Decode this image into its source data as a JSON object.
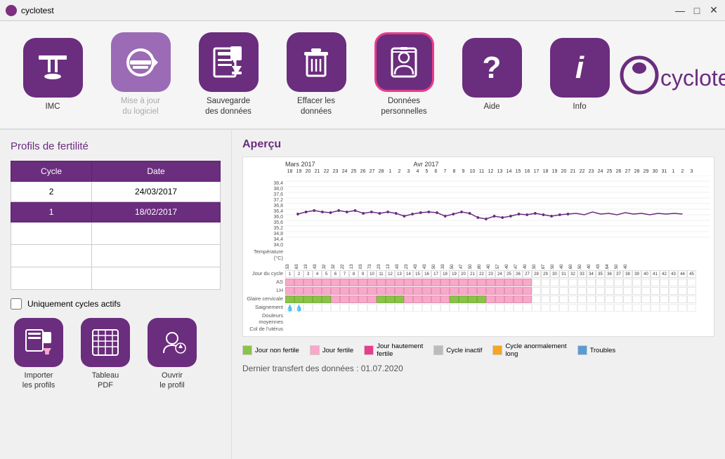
{
  "titleBar": {
    "title": "cyclotest",
    "minimize": "—",
    "maximize": "□",
    "close": "✕"
  },
  "toolbar": {
    "items": [
      {
        "id": "imc",
        "label": "IMC",
        "icon": "imc-icon",
        "active": false,
        "disabled": false
      },
      {
        "id": "update",
        "label": "Mise à jour\ndu logiciel",
        "icon": "update-icon",
        "active": false,
        "disabled": true
      },
      {
        "id": "backup",
        "label": "Sauvegarde\ndes données",
        "icon": "backup-icon",
        "active": false,
        "disabled": false
      },
      {
        "id": "delete",
        "label": "Effacer les\ndonnées",
        "icon": "delete-icon",
        "active": false,
        "disabled": false
      },
      {
        "id": "personal",
        "label": "Données\npersonnelles",
        "icon": "personal-icon",
        "active": true,
        "disabled": false
      },
      {
        "id": "help",
        "label": "Aide",
        "icon": "help-icon",
        "active": false,
        "disabled": false
      },
      {
        "id": "info",
        "label": "Info",
        "icon": "info-icon",
        "active": false,
        "disabled": false
      }
    ]
  },
  "logo": {
    "text": "cyclotest®"
  },
  "leftPanel": {
    "title": "Profils de fertilité",
    "table": {
      "headers": [
        "Cycle",
        "Date"
      ],
      "rows": [
        {
          "cycle": "2",
          "date": "24/03/2017",
          "active": false
        },
        {
          "cycle": "1",
          "date": "18/02/2017",
          "active": true
        },
        {
          "cycle": "",
          "date": "",
          "active": false
        },
        {
          "cycle": "",
          "date": "",
          "active": false
        },
        {
          "cycle": "",
          "date": "",
          "active": false
        }
      ]
    },
    "checkbox": {
      "label": "Uniquement cycles actifs",
      "checked": false
    },
    "buttons": [
      {
        "id": "import",
        "label": "Importer\nles profils",
        "icon": "import-icon"
      },
      {
        "id": "tableau",
        "label": "Tableau\nPDF",
        "icon": "tableau-icon"
      },
      {
        "id": "open",
        "label": "Ouvrir\nle profil",
        "icon": "open-icon"
      }
    ]
  },
  "rightPanel": {
    "title": "Aperçu",
    "chartMonths": [
      "Mars 2017",
      "Avr 2017"
    ],
    "yLabels": [
      "38,4",
      "38,0",
      "37,6",
      "37,2",
      "36,8",
      "36,4",
      "36,0",
      "35,6",
      "35,2",
      "34,8",
      "34,4",
      "34,0"
    ],
    "rowLabels": {
      "jourDuCycle": "Jour du cycle",
      "as": "AS",
      "lh": "LH",
      "glaire": "Glaire cervicale",
      "temperature": "Température (°C)",
      "saignement": "Saignement",
      "douleurs": "Douleurs moyennes",
      "col": "Col de l'utérus"
    },
    "legend": [
      {
        "label": "Jour non fertile",
        "color": "#8bc34a"
      },
      {
        "label": "Jour fertile",
        "color": "#f9a8c9"
      },
      {
        "label": "Jour hautement\nfertile",
        "color": "#e83d8a"
      },
      {
        "label": "Cycle inactif",
        "color": "#bbb"
      },
      {
        "label": "Cycle anormalement\nlong",
        "color": "#f5a623"
      },
      {
        "label": "Troubles",
        "color": "#5b9bd5"
      }
    ],
    "transferText": "Dernier transfert des données : 01.07.2020"
  }
}
